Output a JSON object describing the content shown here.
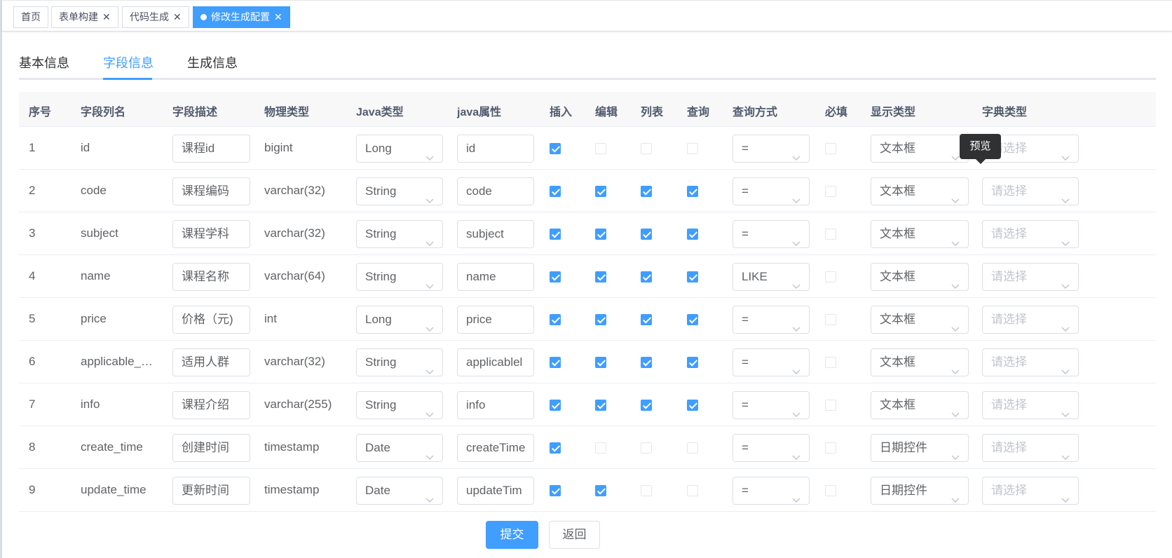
{
  "tags": [
    {
      "label": "首页",
      "closable": false,
      "active": false
    },
    {
      "label": "表单构建",
      "closable": true,
      "active": false
    },
    {
      "label": "代码生成",
      "closable": true,
      "active": false
    },
    {
      "label": "修改生成配置",
      "closable": true,
      "active": true
    }
  ],
  "tabs": [
    "基本信息",
    "字段信息",
    "生成信息"
  ],
  "active_tab": "字段信息",
  "columns": [
    "序号",
    "字段列名",
    "字段描述",
    "物理类型",
    "Java类型",
    "java属性",
    "插入",
    "编辑",
    "列表",
    "查询",
    "查询方式",
    "必填",
    "显示类型",
    "字典类型"
  ],
  "rows": [
    {
      "no": "1",
      "col": "id",
      "desc": "课程id",
      "phys": "bigint",
      "java_type": "Long",
      "java_prop": "id",
      "insert": true,
      "edit": false,
      "list": false,
      "query": false,
      "query_type": "=",
      "required": false,
      "display": "文本框",
      "dict": "请选择"
    },
    {
      "no": "2",
      "col": "code",
      "desc": "课程编码",
      "phys": "varchar(32)",
      "java_type": "String",
      "java_prop": "code",
      "insert": true,
      "edit": true,
      "list": true,
      "query": true,
      "query_type": "=",
      "required": false,
      "display": "文本框",
      "dict": "请选择"
    },
    {
      "no": "3",
      "col": "subject",
      "desc": "课程学科",
      "phys": "varchar(32)",
      "java_type": "String",
      "java_prop": "subject",
      "insert": true,
      "edit": true,
      "list": true,
      "query": true,
      "query_type": "=",
      "required": false,
      "display": "文本框",
      "dict": "请选择"
    },
    {
      "no": "4",
      "col": "name",
      "desc": "课程名称",
      "phys": "varchar(64)",
      "java_type": "String",
      "java_prop": "name",
      "insert": true,
      "edit": true,
      "list": true,
      "query": true,
      "query_type": "LIKE",
      "required": false,
      "display": "文本框",
      "dict": "请选择"
    },
    {
      "no": "5",
      "col": "price",
      "desc": "价格（元)",
      "phys": "int",
      "java_type": "Long",
      "java_prop": "price",
      "insert": true,
      "edit": true,
      "list": true,
      "query": true,
      "query_type": "=",
      "required": false,
      "display": "文本框",
      "dict": "请选择"
    },
    {
      "no": "6",
      "col": "applicable_…",
      "desc": "适用人群",
      "phys": "varchar(32)",
      "java_type": "String",
      "java_prop": "applicablel",
      "insert": true,
      "edit": true,
      "list": true,
      "query": true,
      "query_type": "=",
      "required": false,
      "display": "文本框",
      "dict": "请选择"
    },
    {
      "no": "7",
      "col": "info",
      "desc": "课程介绍",
      "phys": "varchar(255)",
      "java_type": "String",
      "java_prop": "info",
      "insert": true,
      "edit": true,
      "list": true,
      "query": true,
      "query_type": "=",
      "required": false,
      "display": "文本框",
      "dict": "请选择"
    },
    {
      "no": "8",
      "col": "create_time",
      "desc": "创建时间",
      "phys": "timestamp",
      "java_type": "Date",
      "java_prop": "createTime",
      "insert": true,
      "edit": false,
      "list": false,
      "query": false,
      "query_type": "=",
      "required": false,
      "display": "日期控件",
      "dict": "请选择"
    },
    {
      "no": "9",
      "col": "update_time",
      "desc": "更新时间",
      "phys": "timestamp",
      "java_type": "Date",
      "java_prop": "updateTim",
      "insert": true,
      "edit": true,
      "list": false,
      "query": false,
      "query_type": "=",
      "required": false,
      "display": "日期控件",
      "dict": "请选择"
    }
  ],
  "tooltip": "预览",
  "buttons": {
    "submit": "提交",
    "back": "返回"
  },
  "colors": {
    "primary": "#409eff",
    "header_bg": "#f8f8f9",
    "tooltip_bg": "#303133"
  }
}
